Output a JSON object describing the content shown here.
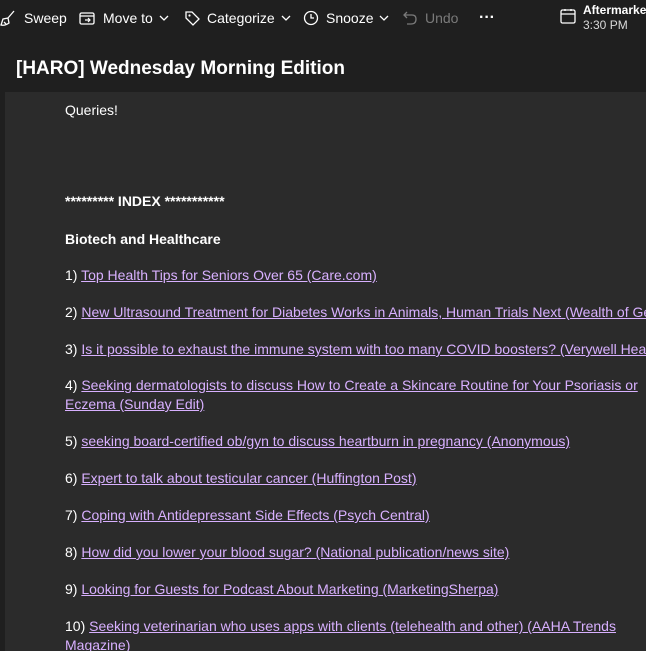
{
  "toolbar": {
    "sweep_label": "Sweep",
    "move_label": "Move to",
    "categorize_label": "Categorize",
    "snooze_label": "Snooze",
    "undo_label": "Undo",
    "more_label": "···",
    "event_title": "Aftermarket",
    "event_time": "3:30 PM"
  },
  "message": {
    "subject": "[HARO] Wednesday Morning Edition",
    "intro": "Queries!",
    "index_heading": "********* INDEX ***********",
    "section_heading": "Biotech and Healthcare",
    "queries": [
      {
        "num": "1)",
        "link": "Top Health Tips for Seniors Over 65 (Care.com)"
      },
      {
        "num": "2)",
        "link": "New Ultrasound Treatment for Diabetes Works in Animals, Human Trials Next (Wealth of Ge"
      },
      {
        "num": "3)",
        "link": "Is it possible to exhaust the immune system with too many COVID boosters? (Verywell Healt"
      },
      {
        "num": "4)",
        "link": "Seeking dermatologists to discuss How to Create a Skincare Routine for Your Psoriasis or Eczema (Sunday Edit)"
      },
      {
        "num": "5)",
        "link": "seeking board-certified ob/gyn to discuss heartburn in pregnancy (Anonymous)"
      },
      {
        "num": "6)",
        "link": "Expert to talk about testicular cancer (Huffington Post)"
      },
      {
        "num": "7)",
        "link": "Coping with Antidepressant Side Effects (Psych Central)"
      },
      {
        "num": "8)",
        "link": "How did you lower your blood sugar? (National publication/news site)"
      },
      {
        "num": "9)",
        "link": "Looking for Guests for Podcast About Marketing (MarketingSherpa)"
      },
      {
        "num": "10)",
        "link": "Seeking veterinarian who uses apps with clients (telehealth and other) (AAHA Trends Magazine)"
      }
    ]
  },
  "colors": {
    "background": "#1f1f1f",
    "reading_pane": "#2b2b2b",
    "link": "#d8b0ff",
    "disabled": "#7a7a7a"
  }
}
